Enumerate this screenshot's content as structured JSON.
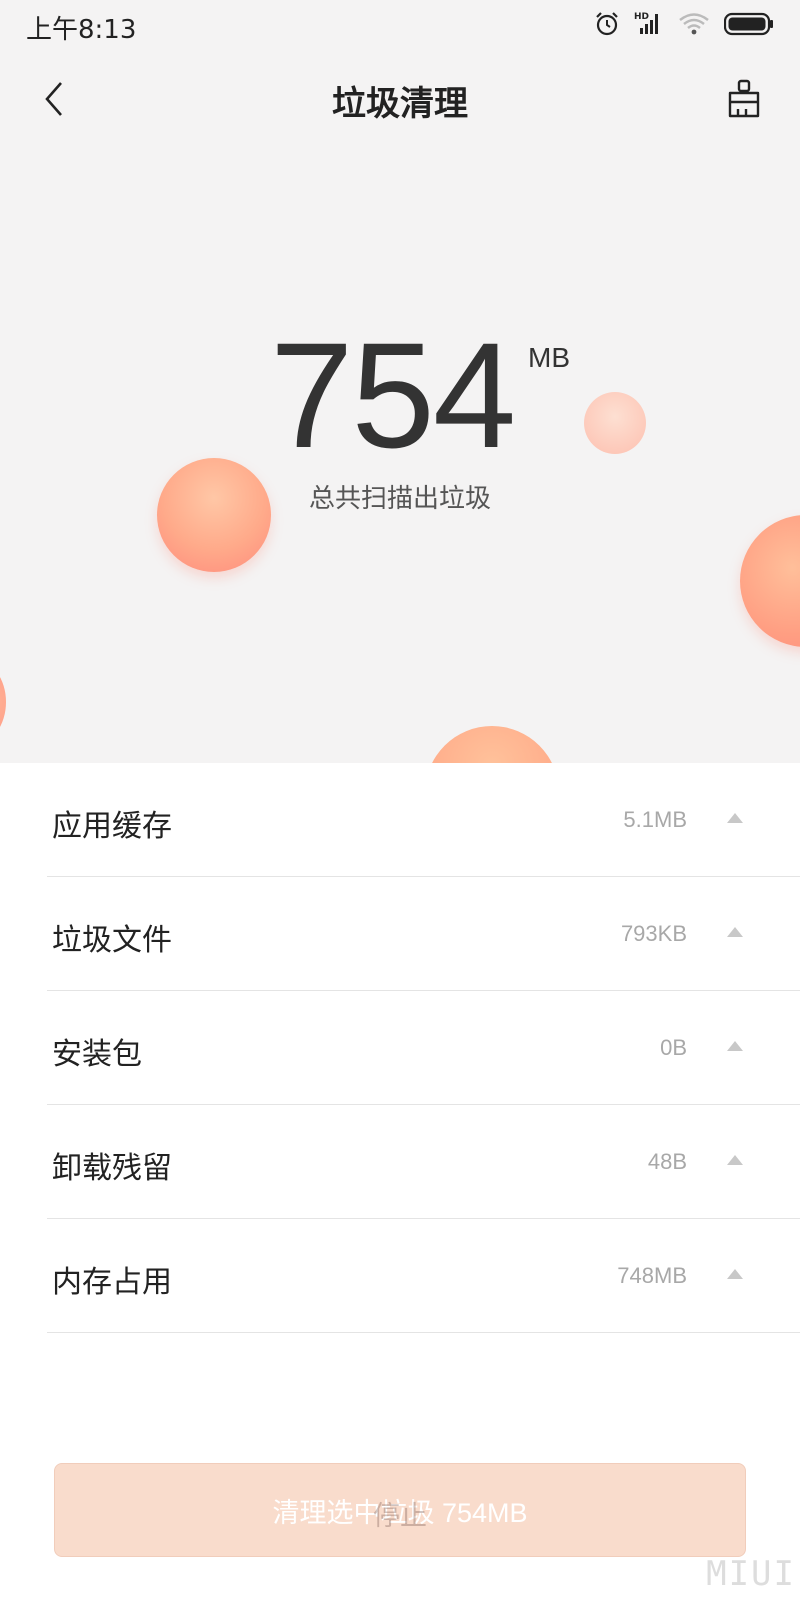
{
  "status_bar": {
    "time": "上午8:13",
    "icons": [
      "alarm-icon",
      "hd-signal-icon",
      "wifi-icon",
      "battery-icon"
    ],
    "signal_badge": "HD"
  },
  "nav": {
    "title": "垃圾清理",
    "back_icon": "chevron-left-icon",
    "action_icon": "broom-clean-icon"
  },
  "summary": {
    "size_value": "754",
    "size_unit": "MB",
    "caption": "总共扫描出垃圾"
  },
  "categories": [
    {
      "label": "应用缓存",
      "size": "5.1MB"
    },
    {
      "label": "垃圾文件",
      "size": "793KB"
    },
    {
      "label": "安装包",
      "size": "0B"
    },
    {
      "label": "卸载残留",
      "size": "48B"
    },
    {
      "label": "内存占用",
      "size": "748MB"
    }
  ],
  "action_button": {
    "label": "清理选中垃圾 754MB",
    "overlay_label": "停止"
  },
  "watermark": "MIUI",
  "colors": {
    "background_top": "#f4f3f3",
    "accent": "#ff8b7c",
    "button_bg": "#f9dccc"
  }
}
